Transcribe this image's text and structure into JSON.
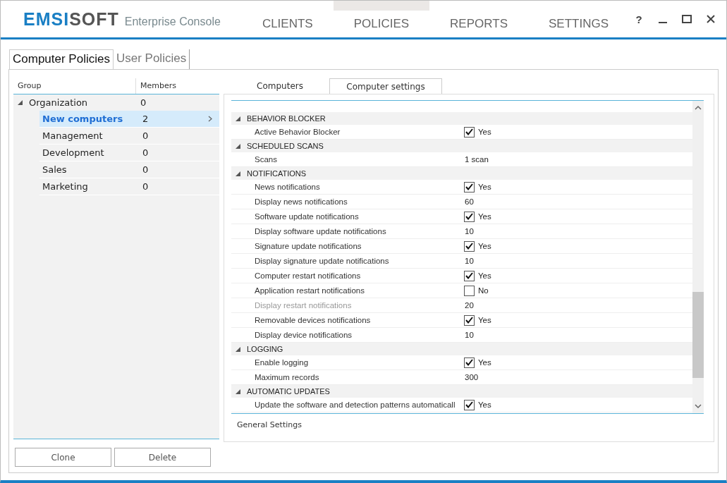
{
  "header": {
    "logo": {
      "part_1": "EMSI",
      "part_2": "SOFT",
      "product": "Enterprise Console"
    },
    "nav": [
      {
        "label": "CLIENTS",
        "selected": false
      },
      {
        "label": "POLICIES",
        "selected": true
      },
      {
        "label": "REPORTS",
        "selected": false
      },
      {
        "label": "SETTINGS",
        "selected": false
      }
    ],
    "help": "?"
  },
  "policy_tabs": [
    {
      "label": "Computer Policies",
      "selected": true
    },
    {
      "label": "User Policies",
      "selected": false
    }
  ],
  "groups": {
    "columns": [
      "Group",
      "Members"
    ],
    "rows": [
      {
        "name": "Organization",
        "members": "0",
        "expanded": true,
        "selected": false,
        "children": [
          {
            "name": "New computers",
            "members": "2",
            "selected": true
          },
          {
            "name": "Management",
            "members": "0",
            "selected": false
          },
          {
            "name": "Development",
            "members": "0",
            "selected": false
          },
          {
            "name": "Sales",
            "members": "0",
            "selected": false
          },
          {
            "name": "Marketing",
            "members": "0",
            "selected": false
          }
        ]
      }
    ]
  },
  "detail_tabs": [
    {
      "label": "Computers",
      "selected": false
    },
    {
      "label": "Computer settings",
      "selected": true
    }
  ],
  "settings": [
    {
      "title": "BEHAVIOR BLOCKER",
      "expanded": true,
      "items": [
        {
          "kind": "checkbox",
          "label": "Active Behavior Blocker",
          "checked": true,
          "value": "Yes",
          "disabled": false
        }
      ]
    },
    {
      "title": "SCHEDULED SCANS",
      "expanded": true,
      "items": [
        {
          "kind": "text",
          "label": "Scans",
          "value": "1 scan",
          "disabled": false
        }
      ]
    },
    {
      "title": "NOTIFICATIONS",
      "expanded": true,
      "items": [
        {
          "kind": "checkbox",
          "label": "News notifications",
          "checked": true,
          "value": "Yes",
          "disabled": false
        },
        {
          "kind": "text",
          "label": "Display news notifications",
          "value": "60",
          "disabled": false
        },
        {
          "kind": "checkbox",
          "label": "Software update notifications",
          "checked": true,
          "value": "Yes",
          "disabled": false
        },
        {
          "kind": "text",
          "label": "Display software update notifications",
          "value": "10",
          "disabled": false
        },
        {
          "kind": "checkbox",
          "label": "Signature update notifications",
          "checked": true,
          "value": "Yes",
          "disabled": false
        },
        {
          "kind": "text",
          "label": "Display signature update notifications",
          "value": "10",
          "disabled": false
        },
        {
          "kind": "checkbox",
          "label": "Computer restart notifications",
          "checked": true,
          "value": "Yes",
          "disabled": false
        },
        {
          "kind": "checkbox",
          "label": "Application restart notifications",
          "checked": false,
          "value": "No",
          "disabled": false
        },
        {
          "kind": "text",
          "label": "Display restart notifications",
          "value": "20",
          "disabled": true
        },
        {
          "kind": "checkbox",
          "label": "Removable devices notifications",
          "checked": true,
          "value": "Yes",
          "disabled": false
        },
        {
          "kind": "text",
          "label": "Display device notifications",
          "value": "10",
          "disabled": false
        }
      ]
    },
    {
      "title": "LOGGING",
      "expanded": true,
      "items": [
        {
          "kind": "checkbox",
          "label": "Enable logging",
          "checked": true,
          "value": "Yes",
          "disabled": false
        },
        {
          "kind": "text",
          "label": "Maximum records",
          "value": "300",
          "disabled": false
        }
      ]
    },
    {
      "title": "AUTOMATIC UPDATES",
      "expanded": true,
      "items": [
        {
          "kind": "checkbox",
          "label": "Update the software and detection patterns automaticall",
          "checked": true,
          "value": "Yes",
          "disabled": false
        }
      ]
    }
  ],
  "settings_footer": "General Settings",
  "buttons": [
    "Clone",
    "Delete"
  ]
}
